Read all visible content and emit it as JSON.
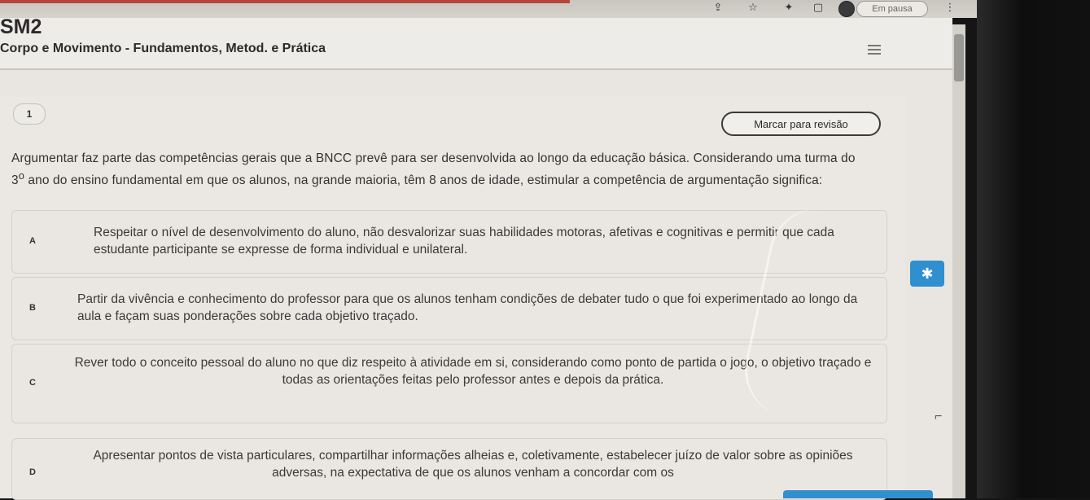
{
  "browser": {
    "pause_label": "Em pausa",
    "icons": [
      "install-icon",
      "star-icon",
      "puzzle-icon",
      "tab-icon",
      "avatar",
      "menu-dots-icon"
    ]
  },
  "header": {
    "course_code": "SM2",
    "course_title": "Corpo e Movimento - Fundamentos, Metod. e Prática"
  },
  "question": {
    "number": "1",
    "mark_review_label": "Marcar para revisão",
    "text_before_sup": "Argumentar faz parte das competências gerais que a BNCC prevê para ser desenvolvida ao longo da educação básica. Considerando uma turma do 3",
    "sup": "o",
    "text_after_sup": " ano do ensino fundamental em que os alunos, na grande maioria, têm 8 anos de idade, estimular a competência de argumentação significa:",
    "options": [
      {
        "letter": "A",
        "text": "Respeitar o nível de desenvolvimento do aluno, não desvalorizar suas habilidades motoras, afetivas e cognitivas e permitir que cada estudante participante se expresse de forma individual e unilateral."
      },
      {
        "letter": "B",
        "text": "Partir da vivência e conhecimento do professor para que os alunos tenham condições de debater tudo o que foi experimentado ao longo da aula e façam suas ponderações sobre cada objetivo traçado."
      },
      {
        "letter": "C",
        "text": "Rever todo o conceito pessoal do aluno no que diz respeito à atividade em si, considerando como ponto de partida o jogo, o objetivo traçado e todas as orientações feitas pelo professor antes e depois da prática."
      },
      {
        "letter": "D",
        "text": "Apresentar pontos de vista particulares, compartilhar informações alheias e, coletivamente, estabelecer juízo de valor sobre as opiniões adversas, na expectativa de que os alunos venham a concordar com os"
      }
    ]
  },
  "colors": {
    "accent_blue": "#2f8fcf",
    "page_bg": "#e9e6e1",
    "text": "#333333"
  }
}
